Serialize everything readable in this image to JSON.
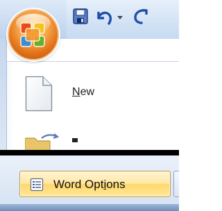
{
  "office_button": {
    "icon": "office-logo-icon"
  },
  "quick_access_toolbar": {
    "save_icon": "save-icon",
    "undo_icon": "undo-icon",
    "dropdown_icon": "chevron-down-icon",
    "redo_icon": "redo-icon"
  },
  "menu": {
    "new": {
      "accel": "N",
      "rest": "ew",
      "icon": "new-document-icon"
    },
    "open": {
      "icon": "open-folder-icon"
    }
  },
  "footer": {
    "word_options": {
      "pre": "Word Opt",
      "accel": "i",
      "post": "ons",
      "icon": "word-options-icon"
    }
  },
  "colors": {
    "ribbon": "#cfdff3",
    "orb": "#e6771d",
    "highlight": "#ffd86b"
  }
}
